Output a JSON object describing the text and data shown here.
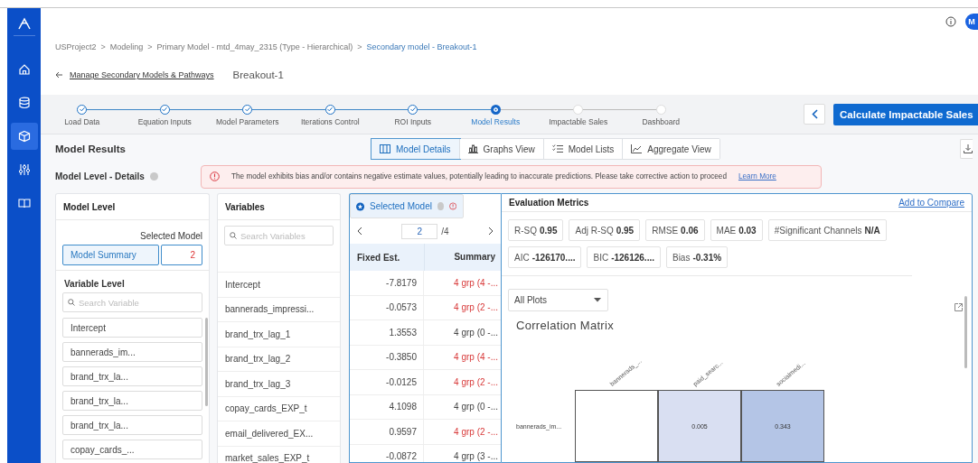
{
  "sidebar": {
    "items": [
      {
        "selected": false
      },
      {
        "selected": false
      },
      {
        "selected": true
      },
      {
        "selected": false
      },
      {
        "selected": false
      }
    ]
  },
  "header": {
    "avatar": "M",
    "breadcrumb": [
      {
        "label": "USProject2",
        "current": false
      },
      {
        "label": "Modeling",
        "current": false
      },
      {
        "label": "Primary Model - mtd_4may_2315 (Type - Hierarchical)",
        "current": false
      },
      {
        "label": "Secondary model - Breakout-1",
        "current": true
      }
    ],
    "separator": ">",
    "back_link": "Manage Secondary Models & Pathways",
    "page_title": "Breakout-1"
  },
  "stepper": {
    "steps": [
      {
        "label": "Load Data",
        "completed": true,
        "selected": false
      },
      {
        "label": "Equation Inputs",
        "completed": true,
        "selected": false
      },
      {
        "label": "Model Parameters",
        "completed": true,
        "selected": false
      },
      {
        "label": "Iterations Control",
        "completed": true,
        "selected": false
      },
      {
        "label": "ROI Inputs",
        "completed": true,
        "selected": false
      },
      {
        "label": "Model Results",
        "completed": false,
        "selected": true
      },
      {
        "label": "Impactable Sales",
        "completed": false,
        "selected": false
      },
      {
        "label": "Dashboard",
        "completed": false,
        "selected": false
      }
    ],
    "next_button": "Calculate Impactable Sales"
  },
  "section_title": "Model Results",
  "view_tabs": [
    {
      "label": "Model Details",
      "selected": true
    },
    {
      "label": "Graphs View",
      "selected": false
    },
    {
      "label": "Model Lists",
      "selected": false
    },
    {
      "label": "Aggregate View",
      "selected": false
    }
  ],
  "subtitle": "Model Level - Details",
  "alert": {
    "message": "The model exhibits bias and/or contains negative estimate values, potentially leading to inaccurate predictions. Please take corrective action to proceed",
    "link": "Learn More"
  },
  "model_level": {
    "title": "Model Level",
    "selected_model_label": "Selected Model",
    "summary_button": "Model Summary",
    "selected_model_value": "2",
    "variable_level_title": "Variable Level",
    "search_placeholder": "Search Variable",
    "items": [
      "Intercept",
      "bannerads_im...",
      "brand_trx_la...",
      "brand_trx_la...",
      "brand_trx_la...",
      "copay_cards_..."
    ]
  },
  "variables": {
    "title": "Variables",
    "search_placeholder": "Search Variables",
    "rows": [
      "Intercept",
      "bannerads_impressi...",
      "brand_trx_lag_1",
      "brand_trx_lag_2",
      "brand_trx_lag_3",
      "copay_cards_EXP_t",
      "email_delivered_EX...",
      "market_sales_EXP_t"
    ]
  },
  "selected_model": {
    "title": "Selected Model",
    "page": "2",
    "page_total": "/4",
    "columns": [
      "Fixed Est.",
      "Summary"
    ],
    "rows": [
      {
        "estimate": "-7.8179",
        "summary": "4 grp (4 -...",
        "warning": true
      },
      {
        "estimate": "-0.0573",
        "summary": "4 grp (2 -...",
        "warning": true
      },
      {
        "estimate": "1.3553",
        "summary": "4 grp (0 -...",
        "warning": false
      },
      {
        "estimate": "-0.3850",
        "summary": "4 grp (4 -...",
        "warning": true
      },
      {
        "estimate": "-0.0125",
        "summary": "4 grp (2 -...",
        "warning": true
      },
      {
        "estimate": "4.1098",
        "summary": "4 grp (0 -...",
        "warning": false
      },
      {
        "estimate": "0.9597",
        "summary": "4 grp (2 -...",
        "warning": true
      },
      {
        "estimate": "-0.0872",
        "summary": "4 grp (3 -...",
        "warning": false
      }
    ]
  },
  "evaluation": {
    "title": "Evaluation Metrics",
    "compare_link": "Add to Compare",
    "metrics": [
      {
        "label": "R-SQ",
        "value": "0.95"
      },
      {
        "label": "Adj R-SQ",
        "value": "0.95"
      },
      {
        "label": "RMSE",
        "value": "0.06"
      },
      {
        "label": "MAE",
        "value": "0.03"
      },
      {
        "label": "#Significant Channels",
        "value": "N/A"
      },
      {
        "label": "AIC",
        "value": "-126170...."
      },
      {
        "label": "BIC",
        "value": "-126126...."
      },
      {
        "label": "Bias",
        "value": "-0.31%"
      }
    ],
    "plot_select": "All Plots",
    "plot_title": "Correlation Matrix",
    "matrix": {
      "columns": [
        "bannerads_...",
        "paid_searc...",
        "socialmedi..."
      ],
      "rows": [
        {
          "label": "bannerads_im...",
          "cells": [
            {
              "text": "",
              "color": "#ffffff"
            },
            {
              "text": "0.005",
              "color": "#d9dff2"
            },
            {
              "text": "0.343",
              "color": "#b4c5e6"
            }
          ]
        }
      ]
    }
  }
}
